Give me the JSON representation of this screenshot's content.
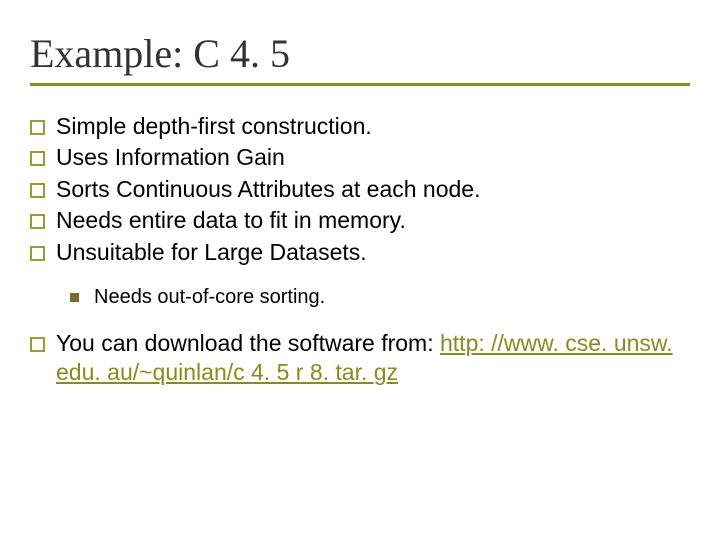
{
  "title": "Example: C 4. 5",
  "bullets": {
    "b0": "Simple depth-first construction.",
    "b1": "Uses Information Gain",
    "b2": "Sorts Continuous Attributes at each node.",
    "b3": "Needs entire data to fit in memory.",
    "b4": "Unsuitable for Large Datasets.",
    "sub0": "Needs out-of-core sorting.",
    "b5": "You can download the software from:"
  },
  "link": {
    "text": "http: //www. cse. unsw. edu. au/~quinlan/c 4. 5 r 8. tar. gz",
    "href": "http://www.cse.unsw.edu.au/~quinlan/c4.5r8.tar.gz"
  },
  "colors": {
    "accent": "#8a8a1f",
    "bullet_border": "#9a9a33",
    "sub_bullet": "#7a6a2f"
  }
}
